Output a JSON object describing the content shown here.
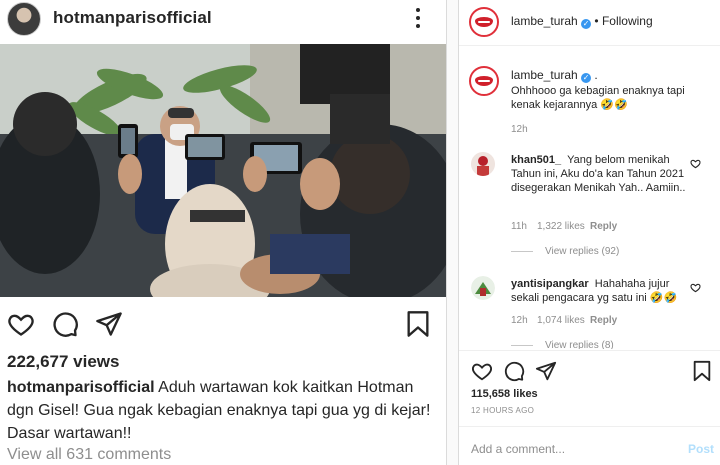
{
  "left": {
    "username": "hotmanparisofficial",
    "views": "222,677 views",
    "caption_user": "hotmanparisofficial",
    "caption_text": " Aduh wartawan kok kaitkan Hotman dgn Gisel!  Gua ngak kebagian enaknya tapi gua yg di kejar! Dasar wartawan!!",
    "view_all": "View all 631 comments"
  },
  "right": {
    "header_username": "lambe_turah",
    "header_follow": "• Following",
    "post_username": "lambe_turah",
    "post_dot": ".",
    "post_text": "Ohhhooo ga kebagian enaknya tapi kenak kejarannya 🤣🤣",
    "post_time": "12h",
    "comments": [
      {
        "user": "khan501_",
        "text": "Yang belom menikah Tahun ini, Aku do'a kan Tahun 2021 disegerakan Menikah Yah.. Aamiin..",
        "time": "11h",
        "likes": "1,322 likes",
        "reply": "Reply",
        "thread": "View replies (92)"
      },
      {
        "user": "yantisipangkar",
        "text": "Hahahaha jujur sekali pengacara yg satu ini 🤣🤣",
        "time": "12h",
        "likes": "1,074 likes",
        "reply": "Reply",
        "thread": "View replies (8)"
      }
    ],
    "likes": "115,658 likes",
    "time_ago": "12 HOURS AGO",
    "add_comment_placeholder": "Add a comment...",
    "post_button": "Post"
  },
  "colors": {
    "verified": "#3897f0",
    "post_button": "#b2dffc",
    "muted": "#8e8e8e",
    "brand_red": "#d0202b"
  },
  "icons": [
    "more-icon",
    "heart-icon",
    "comment-icon",
    "share-icon",
    "bookmark-icon",
    "verified-icon",
    "small-heart-icon"
  ]
}
